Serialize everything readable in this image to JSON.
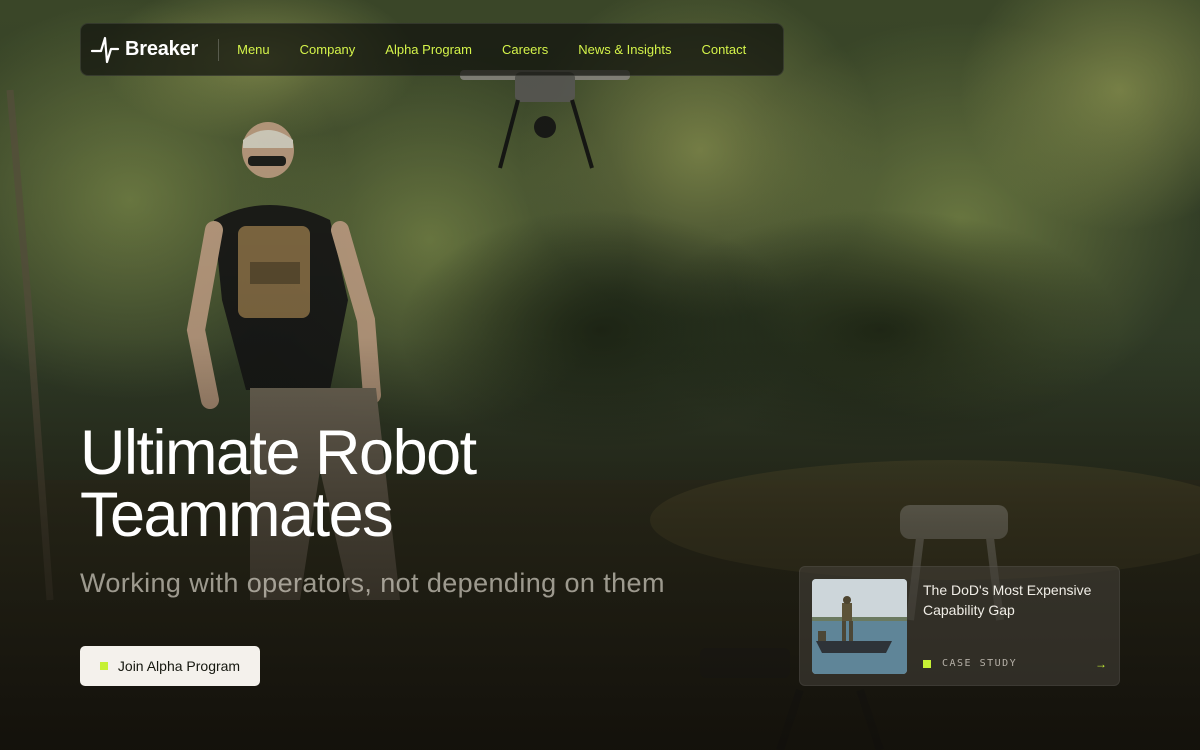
{
  "brand": {
    "name": "Breaker"
  },
  "nav": {
    "items": [
      {
        "label": "Menu"
      },
      {
        "label": "Company"
      },
      {
        "label": "Alpha Program"
      },
      {
        "label": "Careers"
      },
      {
        "label": "News & Insights"
      },
      {
        "label": "Contact"
      }
    ]
  },
  "hero": {
    "title_line1": "Ultimate Robot",
    "title_line2": "Teammates",
    "subtitle": "Working with operators, not depending on them",
    "cta_label": "Join Alpha Program"
  },
  "card": {
    "title": "The DoD's Most Expensive Capability Gap",
    "tag": "CASE STUDY",
    "arrow_icon": "arrow-right-icon"
  },
  "colors": {
    "accent": "#c6f135",
    "nav_link": "#d4f34a",
    "button_bg": "#f4f1ec"
  }
}
